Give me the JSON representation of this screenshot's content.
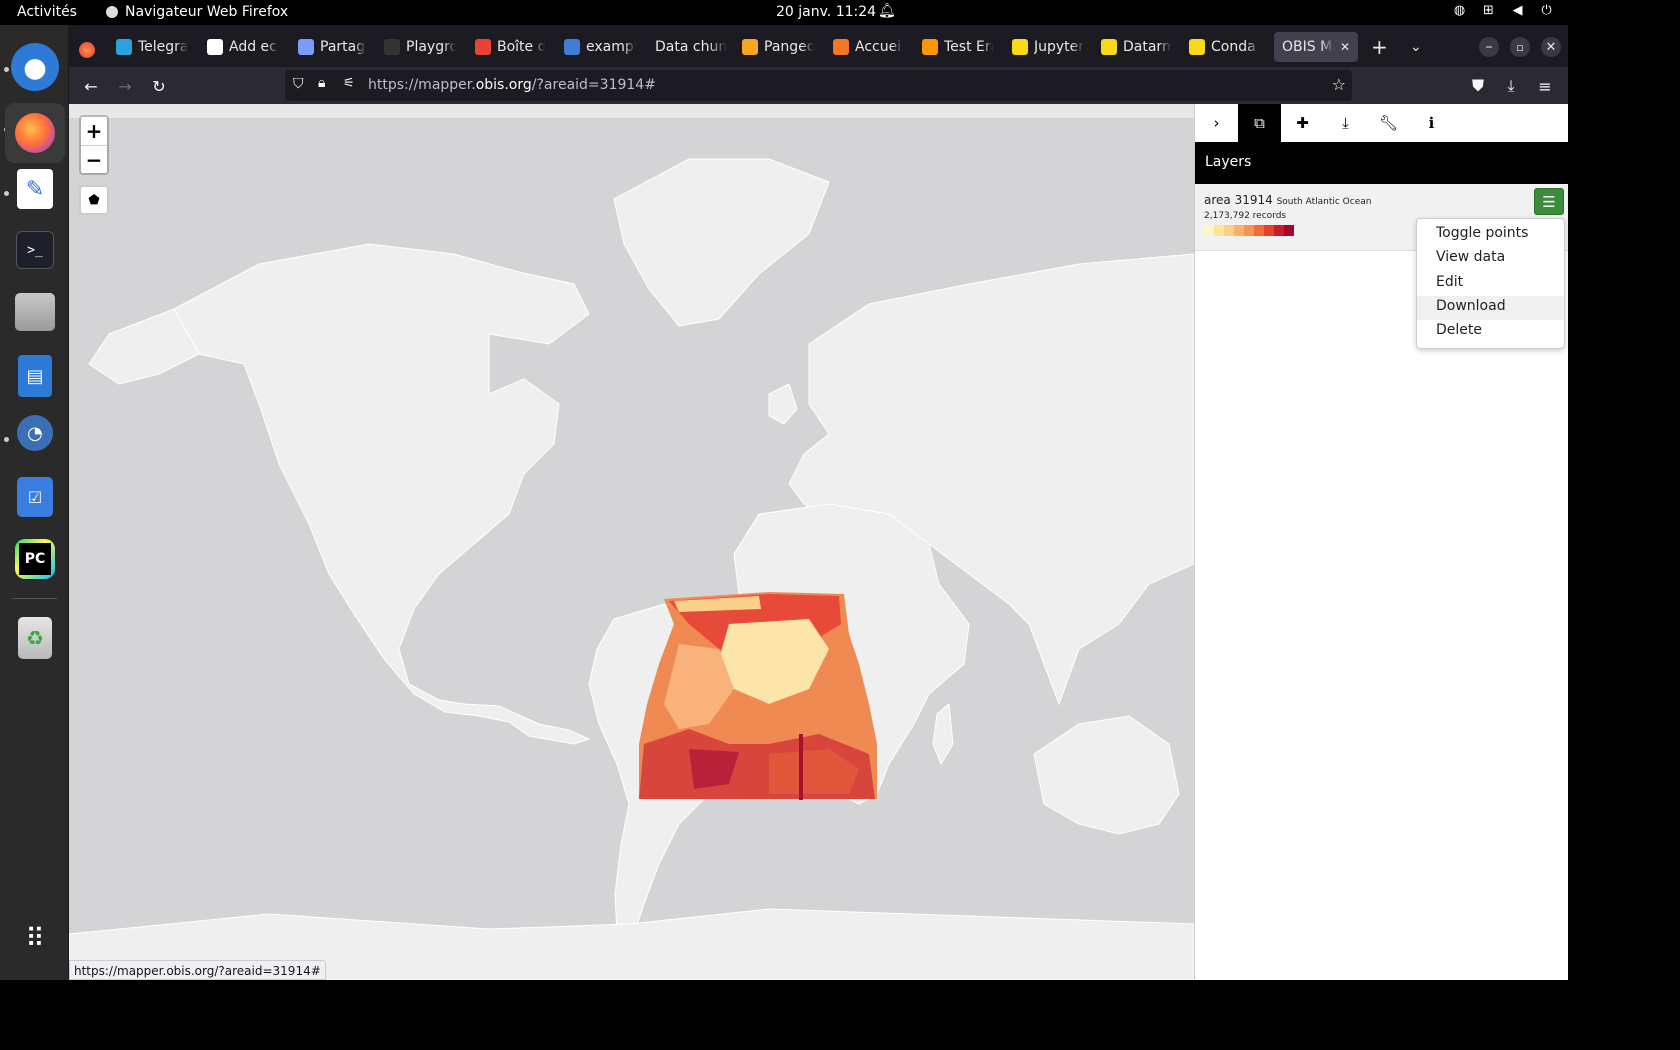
{
  "topbar": {
    "activities": "Activités",
    "app_name": "Navigateur Web Firefox",
    "datetime": "20 janv.  11:24"
  },
  "tabs": [
    {
      "label": "Telegram",
      "color": "#2aa3df"
    },
    {
      "label": "Add eco",
      "color": "#ffffff"
    },
    {
      "label": "Partage",
      "color": "#7a9cff"
    },
    {
      "label": "Playgro",
      "color": "#333333"
    },
    {
      "label": "Boîte de",
      "color": "#ea4335"
    },
    {
      "label": "example",
      "color": "#3d7dd8"
    },
    {
      "label": "Data chunk",
      "color": ""
    },
    {
      "label": "Pangeo",
      "color": "#f6a623"
    },
    {
      "label": "Accueil",
      "color": "#f37726"
    },
    {
      "label": "Test Era",
      "color": "#ff9500"
    },
    {
      "label": "Jupyter",
      "color": "#f7d917"
    },
    {
      "label": "Datarm",
      "color": "#f7d917"
    },
    {
      "label": "Conda s",
      "color": "#f7d917"
    },
    {
      "label": "OBIS Map",
      "color": ""
    }
  ],
  "url": {
    "prefix": "https://mapper.",
    "domain": "obis.org",
    "suffix": "/?areaid=31914#"
  },
  "map": {
    "zoom_in": "+",
    "zoom_out": "−"
  },
  "panel": {
    "header": "Layers",
    "layer": {
      "name": "area 31914",
      "region": "South Atlantic Ocean",
      "records": "2,173,792 records",
      "legend_colors": [
        "#fff5c8",
        "#fde49d",
        "#fdd08a",
        "#fcb169",
        "#f99450",
        "#f26b3a",
        "#e2412c",
        "#c81d2b",
        "#a6062b"
      ]
    },
    "menu": [
      "Toggle points",
      "View data",
      "Edit",
      "Download",
      "Delete"
    ],
    "menu_highlight": "Download"
  },
  "status_url": "https://mapper.obis.org/?areaid=31914#"
}
